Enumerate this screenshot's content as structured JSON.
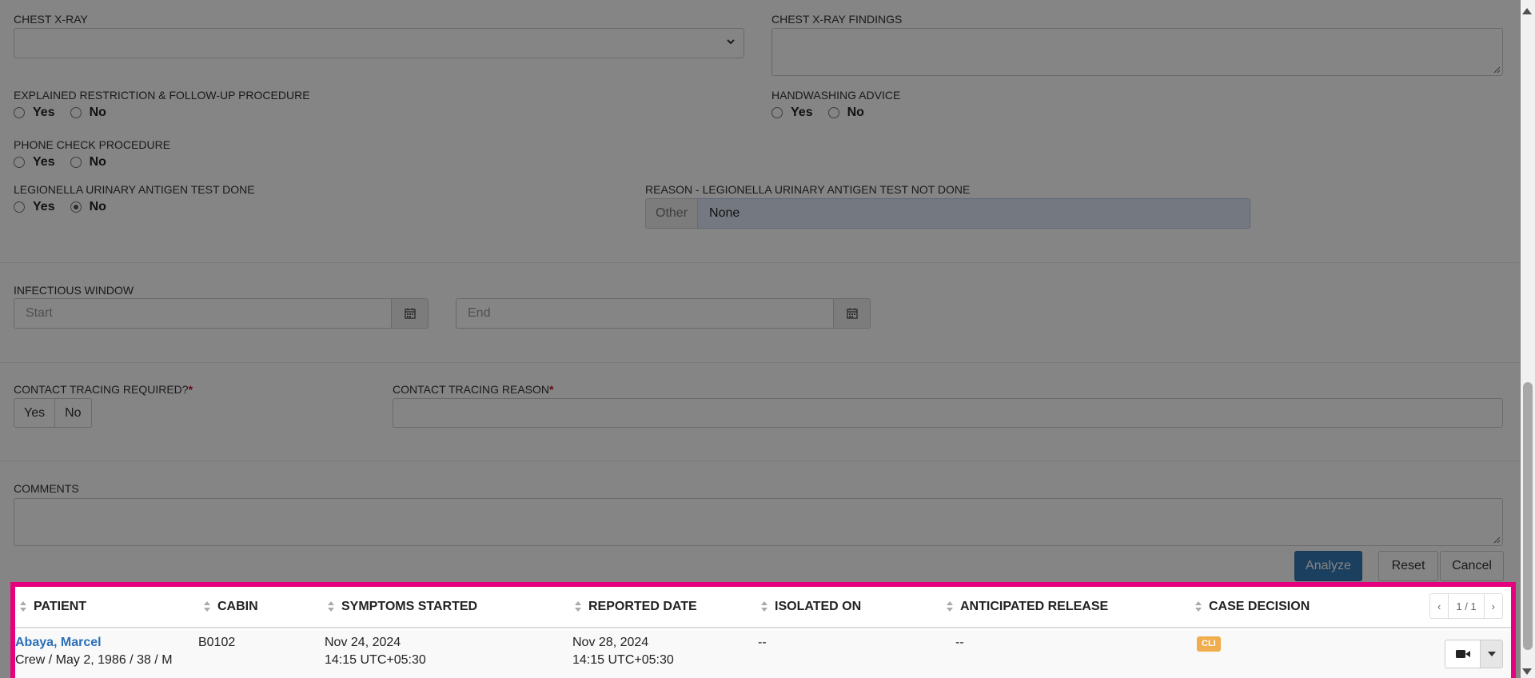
{
  "form": {
    "chest_xray": {
      "label": "CHEST X-RAY",
      "value": ""
    },
    "chest_xray_findings": {
      "label": "CHEST X-RAY FINDINGS",
      "value": ""
    },
    "explained_restriction": {
      "label": "EXPLAINED RESTRICTION & FOLLOW-UP PROCEDURE",
      "yes": "Yes",
      "no": "No",
      "selected": ""
    },
    "handwashing": {
      "label": "HANDWASHING ADVICE",
      "yes": "Yes",
      "no": "No",
      "selected": ""
    },
    "phone_check": {
      "label": "PHONE CHECK PROCEDURE",
      "yes": "Yes",
      "no": "No",
      "selected": ""
    },
    "legionella": {
      "label": "LEGIONELLA URINARY ANTIGEN TEST DONE",
      "yes": "Yes",
      "no": "No",
      "selected": "No"
    },
    "legionella_reason": {
      "label": "REASON - LEGIONELLA URINARY ANTIGEN TEST NOT DONE",
      "addon": "Other",
      "value": "None"
    },
    "infectious_window": {
      "label": "INFECTIOUS WINDOW",
      "start_placeholder": "Start",
      "end_placeholder": "End"
    },
    "contact_tracing_required": {
      "label": "CONTACT TRACING REQUIRED?",
      "required_mark": "*",
      "yes": "Yes",
      "no": "No"
    },
    "contact_tracing_reason": {
      "label": "CONTACT TRACING REASON",
      "required_mark": "*",
      "value": ""
    },
    "comments": {
      "label": "COMMENTS",
      "value": ""
    },
    "buttons": {
      "analyze": "Analyze",
      "reset": "Reset",
      "cancel": "Cancel"
    }
  },
  "table": {
    "columns": [
      "PATIENT",
      "CABIN",
      "SYMPTOMS STARTED",
      "REPORTED DATE",
      "ISOLATED ON",
      "ANTICIPATED RELEASE",
      "CASE DECISION"
    ],
    "pager": {
      "prev": "‹",
      "page": "1 / 1",
      "next": "›"
    },
    "rows": [
      {
        "patient_name": "Abaya, Marcel",
        "patient_details": "Crew / May 2, 1986 / 38 / M",
        "cabin": "B0102",
        "symptoms_date": "Nov 24, 2024",
        "symptoms_time": "14:15 UTC+05:30",
        "reported_date": "Nov 28, 2024",
        "reported_time": "14:15 UTC+05:30",
        "isolated_on": "--",
        "anticipated_release": "--",
        "case_decision": "CLI"
      }
    ]
  },
  "colors": {
    "highlight": "#e6007e",
    "primary": "#337ab7",
    "badge": "#f0ad4e",
    "link": "#2a6fb7"
  },
  "icons": [
    "chevron-down-icon",
    "calendar-icon",
    "video-camera-icon",
    "caret-down-icon",
    "sort-icon"
  ]
}
